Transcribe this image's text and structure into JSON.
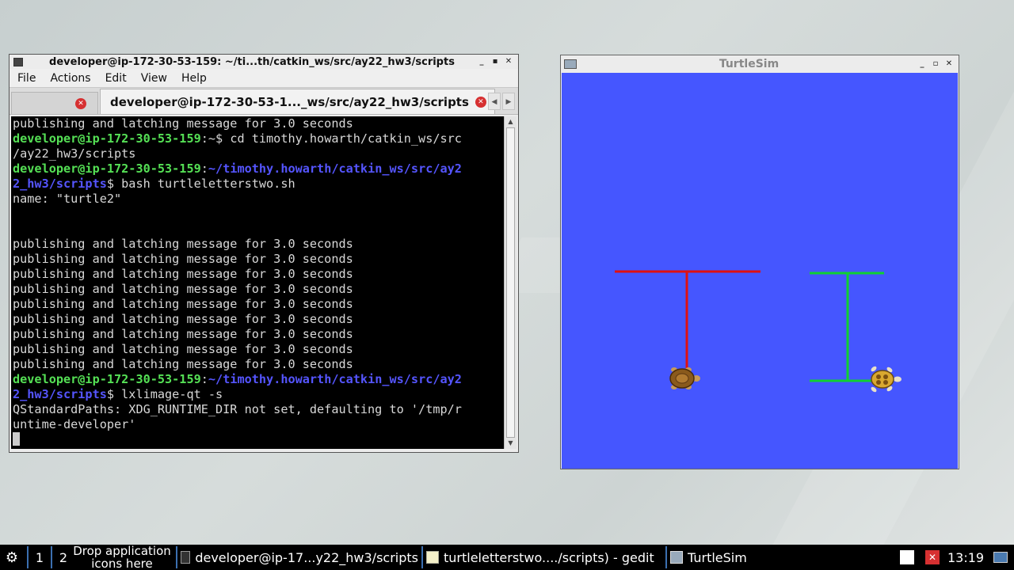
{
  "terminal": {
    "title": "developer@ip-172-30-53-159: ~/ti...th/catkin_ws/src/ay22_hw3/scripts",
    "menu": [
      "File",
      "Actions",
      "Edit",
      "View",
      "Help"
    ],
    "active_tab_label": "developer@ip-172-30-53-1..._ws/src/ay22_hw3/scripts",
    "lines": [
      [
        {
          "t": "publishing and latching message for 3.0 seconds"
        }
      ],
      [
        {
          "t": "developer@ip-172-30-53-159",
          "c": "g"
        },
        {
          "t": ":~$ cd timothy.howarth/catkin_ws/src"
        }
      ],
      [
        {
          "t": "/ay22_hw3/scripts"
        }
      ],
      [
        {
          "t": "developer@ip-172-30-53-159",
          "c": "g"
        },
        {
          "t": ":"
        },
        {
          "t": "~/timothy.howarth/catkin_ws/src/ay2",
          "c": "b"
        }
      ],
      [
        {
          "t": "2_hw3/scripts",
          "c": "b"
        },
        {
          "t": "$ bash turtleletterstwo.sh"
        }
      ],
      [
        {
          "t": "name: \"turtle2\""
        }
      ],
      [
        {
          "t": ""
        }
      ],
      [
        {
          "t": ""
        }
      ],
      [
        {
          "t": "publishing and latching message for 3.0 seconds"
        }
      ],
      [
        {
          "t": "publishing and latching message for 3.0 seconds"
        }
      ],
      [
        {
          "t": "publishing and latching message for 3.0 seconds"
        }
      ],
      [
        {
          "t": "publishing and latching message for 3.0 seconds"
        }
      ],
      [
        {
          "t": "publishing and latching message for 3.0 seconds"
        }
      ],
      [
        {
          "t": "publishing and latching message for 3.0 seconds"
        }
      ],
      [
        {
          "t": "publishing and latching message for 3.0 seconds"
        }
      ],
      [
        {
          "t": "publishing and latching message for 3.0 seconds"
        }
      ],
      [
        {
          "t": "publishing and latching message for 3.0 seconds"
        }
      ],
      [
        {
          "t": "developer@ip-172-30-53-159",
          "c": "g"
        },
        {
          "t": ":"
        },
        {
          "t": "~/timothy.howarth/catkin_ws/src/ay2",
          "c": "b"
        }
      ],
      [
        {
          "t": "2_hw3/scripts",
          "c": "b"
        },
        {
          "t": "$ lxlimage-qt -s"
        }
      ],
      [
        {
          "t": "QStandardPaths: XDG_RUNTIME_DIR not set, defaulting to '/tmp/r"
        }
      ],
      [
        {
          "t": "untime-developer'"
        }
      ]
    ]
  },
  "turtlesim": {
    "title": "TurtleSim",
    "background_color": "#4556ff",
    "pen_colors": {
      "turtle1": "#e01010",
      "turtle2": "#10d030"
    }
  },
  "taskbar": {
    "desktops": [
      "1",
      "2"
    ],
    "drop_text": "Drop application icons here",
    "tasks": [
      {
        "label": "developer@ip-17...y22_hw3/scripts",
        "icon": "terminal-icon"
      },
      {
        "label": "turtleletterstwo..../scripts) - gedit",
        "icon": "text-editor-icon"
      },
      {
        "label": "TurtleSim",
        "icon": "window-icon"
      }
    ],
    "clock": "13:19"
  }
}
